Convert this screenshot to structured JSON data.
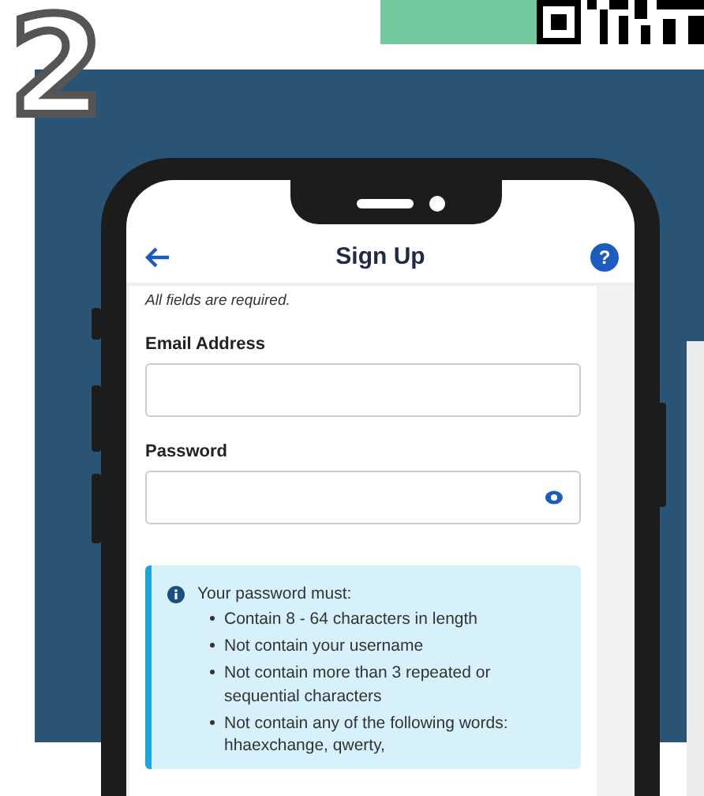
{
  "step_number": "2",
  "screen": {
    "title": "Sign Up",
    "help_label": "?",
    "note": "All fields are required.",
    "fields": [
      {
        "label": "Email Address",
        "kind": "text"
      },
      {
        "label": "Password",
        "kind": "password"
      }
    ],
    "password_rules": {
      "heading": "Your password must:",
      "items": [
        "Contain 8 - 64 characters in length",
        "Not contain your username",
        "Not contain more than 3 repeated or sequential characters",
        "Not contain any of the following words: hhaexchange, qwerty,"
      ]
    }
  }
}
